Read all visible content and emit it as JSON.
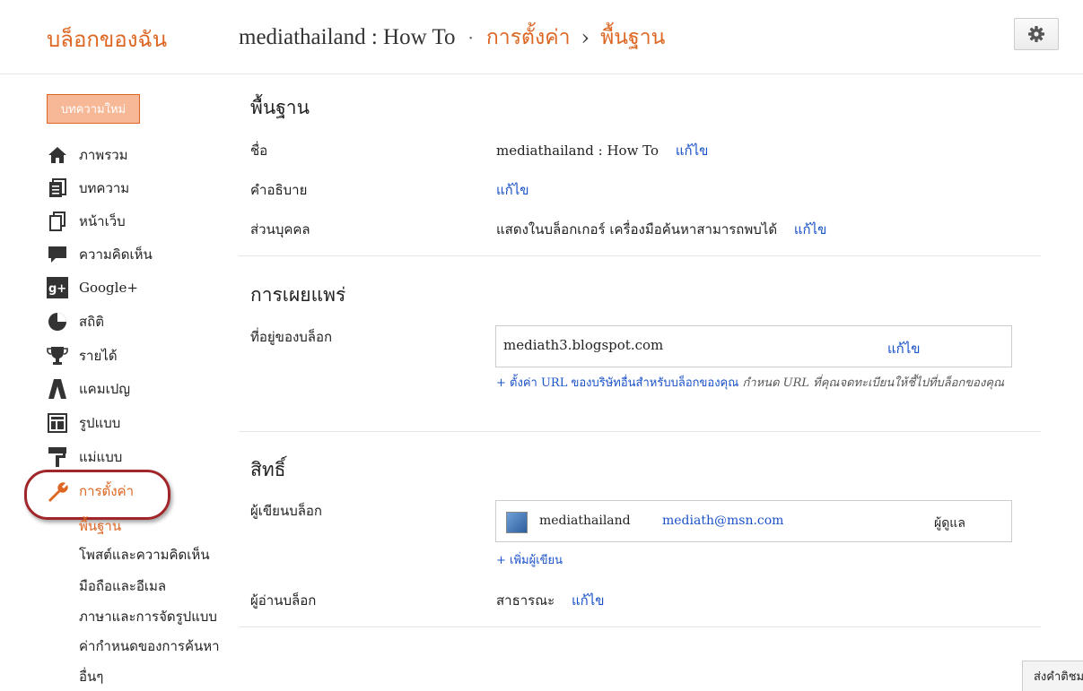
{
  "header": {
    "brand": "บล็อกของฉัน",
    "blog_title": "mediathailand : How To",
    "sep": "·",
    "crumb_settings": "การตั้งค่า",
    "arrow": "›",
    "crumb_basic": "พื้นฐาน"
  },
  "sidebar": {
    "new_post": "บทความใหม่",
    "items": [
      {
        "label": "ภาพรวม",
        "icon": "home-icon"
      },
      {
        "label": "บทความ",
        "icon": "posts-icon"
      },
      {
        "label": "หน้าเว็บ",
        "icon": "pages-icon"
      },
      {
        "label": "ความคิดเห็น",
        "icon": "comments-icon"
      },
      {
        "label": "Google+",
        "icon": "google-plus-icon"
      },
      {
        "label": "สถิติ",
        "icon": "stats-icon"
      },
      {
        "label": "รายได้",
        "icon": "earnings-icon"
      },
      {
        "label": "แคมเปญ",
        "icon": "campaigns-icon"
      },
      {
        "label": "รูปแบบ",
        "icon": "layout-icon"
      },
      {
        "label": "แม่แบบ",
        "icon": "template-icon"
      },
      {
        "label": "การตั้งค่า",
        "icon": "wrench-icon"
      }
    ],
    "sub_items": [
      "พื้นฐาน",
      "โพสต์และความคิดเห็น",
      "มือถือและอีเมล",
      "ภาษาและการจัดรูปแบบ",
      "ค่ากำหนดของการค้นหา",
      "อื่นๆ"
    ]
  },
  "basic": {
    "title": "พื้นฐาน",
    "name_label": "ชื่อ",
    "name_value": "mediathailand : How To",
    "desc_label": "คำอธิบาย",
    "privacy_label": "ส่วนบุคคล",
    "privacy_value": "แสดงในบล็อกเกอร์ เครื่องมือค้นหาสามารถพบได้",
    "edit": "แก้ไข"
  },
  "publishing": {
    "title": "การเผยแพร่",
    "address_label": "ที่อยู่ของบล็อก",
    "address_value": "mediath3.blogspot.com",
    "custom_url_link": "+ ตั้งค่า URL ของบริษัทอื่นสำหรับบล็อกของคุณ",
    "custom_url_note": "กำหนด URL ที่คุณจดทะเบียนให้ชี้ไปที่บล็อกของคุณ"
  },
  "permissions": {
    "title": "สิทธิ์",
    "authors_label": "ผู้เขียนบล็อก",
    "author_name": "mediathailand",
    "author_email": "mediath@msn.com",
    "author_role": "ผู้ดูแล",
    "add_author": "+ เพิ่มผู้เขียน",
    "readers_label": "ผู้อ่านบล็อก",
    "readers_value": "สาธารณะ"
  },
  "footer": {
    "send_feedback": "ส่งคำติชม"
  },
  "colors": {
    "accent": "#dd6622",
    "link": "#1a52c8",
    "highlight_ring": "#a0262a"
  }
}
